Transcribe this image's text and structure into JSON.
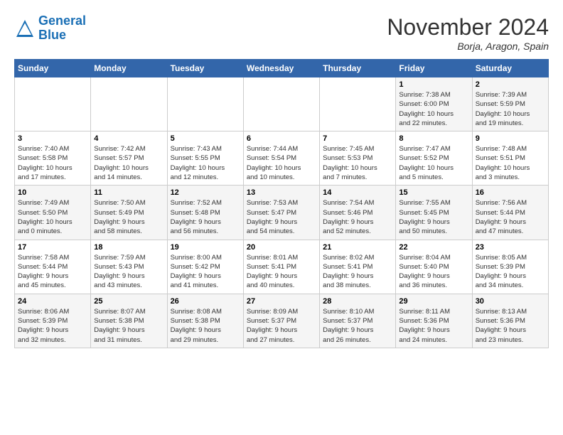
{
  "logo": {
    "text_general": "General",
    "text_blue": "Blue"
  },
  "title": "November 2024",
  "location": "Borja, Aragon, Spain",
  "weekdays": [
    "Sunday",
    "Monday",
    "Tuesday",
    "Wednesday",
    "Thursday",
    "Friday",
    "Saturday"
  ],
  "weeks": [
    [
      {
        "day": "",
        "info": ""
      },
      {
        "day": "",
        "info": ""
      },
      {
        "day": "",
        "info": ""
      },
      {
        "day": "",
        "info": ""
      },
      {
        "day": "",
        "info": ""
      },
      {
        "day": "1",
        "info": "Sunrise: 7:38 AM\nSunset: 6:00 PM\nDaylight: 10 hours\nand 22 minutes."
      },
      {
        "day": "2",
        "info": "Sunrise: 7:39 AM\nSunset: 5:59 PM\nDaylight: 10 hours\nand 19 minutes."
      }
    ],
    [
      {
        "day": "3",
        "info": "Sunrise: 7:40 AM\nSunset: 5:58 PM\nDaylight: 10 hours\nand 17 minutes."
      },
      {
        "day": "4",
        "info": "Sunrise: 7:42 AM\nSunset: 5:57 PM\nDaylight: 10 hours\nand 14 minutes."
      },
      {
        "day": "5",
        "info": "Sunrise: 7:43 AM\nSunset: 5:55 PM\nDaylight: 10 hours\nand 12 minutes."
      },
      {
        "day": "6",
        "info": "Sunrise: 7:44 AM\nSunset: 5:54 PM\nDaylight: 10 hours\nand 10 minutes."
      },
      {
        "day": "7",
        "info": "Sunrise: 7:45 AM\nSunset: 5:53 PM\nDaylight: 10 hours\nand 7 minutes."
      },
      {
        "day": "8",
        "info": "Sunrise: 7:47 AM\nSunset: 5:52 PM\nDaylight: 10 hours\nand 5 minutes."
      },
      {
        "day": "9",
        "info": "Sunrise: 7:48 AM\nSunset: 5:51 PM\nDaylight: 10 hours\nand 3 minutes."
      }
    ],
    [
      {
        "day": "10",
        "info": "Sunrise: 7:49 AM\nSunset: 5:50 PM\nDaylight: 10 hours\nand 0 minutes."
      },
      {
        "day": "11",
        "info": "Sunrise: 7:50 AM\nSunset: 5:49 PM\nDaylight: 9 hours\nand 58 minutes."
      },
      {
        "day": "12",
        "info": "Sunrise: 7:52 AM\nSunset: 5:48 PM\nDaylight: 9 hours\nand 56 minutes."
      },
      {
        "day": "13",
        "info": "Sunrise: 7:53 AM\nSunset: 5:47 PM\nDaylight: 9 hours\nand 54 minutes."
      },
      {
        "day": "14",
        "info": "Sunrise: 7:54 AM\nSunset: 5:46 PM\nDaylight: 9 hours\nand 52 minutes."
      },
      {
        "day": "15",
        "info": "Sunrise: 7:55 AM\nSunset: 5:45 PM\nDaylight: 9 hours\nand 50 minutes."
      },
      {
        "day": "16",
        "info": "Sunrise: 7:56 AM\nSunset: 5:44 PM\nDaylight: 9 hours\nand 47 minutes."
      }
    ],
    [
      {
        "day": "17",
        "info": "Sunrise: 7:58 AM\nSunset: 5:44 PM\nDaylight: 9 hours\nand 45 minutes."
      },
      {
        "day": "18",
        "info": "Sunrise: 7:59 AM\nSunset: 5:43 PM\nDaylight: 9 hours\nand 43 minutes."
      },
      {
        "day": "19",
        "info": "Sunrise: 8:00 AM\nSunset: 5:42 PM\nDaylight: 9 hours\nand 41 minutes."
      },
      {
        "day": "20",
        "info": "Sunrise: 8:01 AM\nSunset: 5:41 PM\nDaylight: 9 hours\nand 40 minutes."
      },
      {
        "day": "21",
        "info": "Sunrise: 8:02 AM\nSunset: 5:41 PM\nDaylight: 9 hours\nand 38 minutes."
      },
      {
        "day": "22",
        "info": "Sunrise: 8:04 AM\nSunset: 5:40 PM\nDaylight: 9 hours\nand 36 minutes."
      },
      {
        "day": "23",
        "info": "Sunrise: 8:05 AM\nSunset: 5:39 PM\nDaylight: 9 hours\nand 34 minutes."
      }
    ],
    [
      {
        "day": "24",
        "info": "Sunrise: 8:06 AM\nSunset: 5:39 PM\nDaylight: 9 hours\nand 32 minutes."
      },
      {
        "day": "25",
        "info": "Sunrise: 8:07 AM\nSunset: 5:38 PM\nDaylight: 9 hours\nand 31 minutes."
      },
      {
        "day": "26",
        "info": "Sunrise: 8:08 AM\nSunset: 5:38 PM\nDaylight: 9 hours\nand 29 minutes."
      },
      {
        "day": "27",
        "info": "Sunrise: 8:09 AM\nSunset: 5:37 PM\nDaylight: 9 hours\nand 27 minutes."
      },
      {
        "day": "28",
        "info": "Sunrise: 8:10 AM\nSunset: 5:37 PM\nDaylight: 9 hours\nand 26 minutes."
      },
      {
        "day": "29",
        "info": "Sunrise: 8:11 AM\nSunset: 5:36 PM\nDaylight: 9 hours\nand 24 minutes."
      },
      {
        "day": "30",
        "info": "Sunrise: 8:13 AM\nSunset: 5:36 PM\nDaylight: 9 hours\nand 23 minutes."
      }
    ]
  ]
}
